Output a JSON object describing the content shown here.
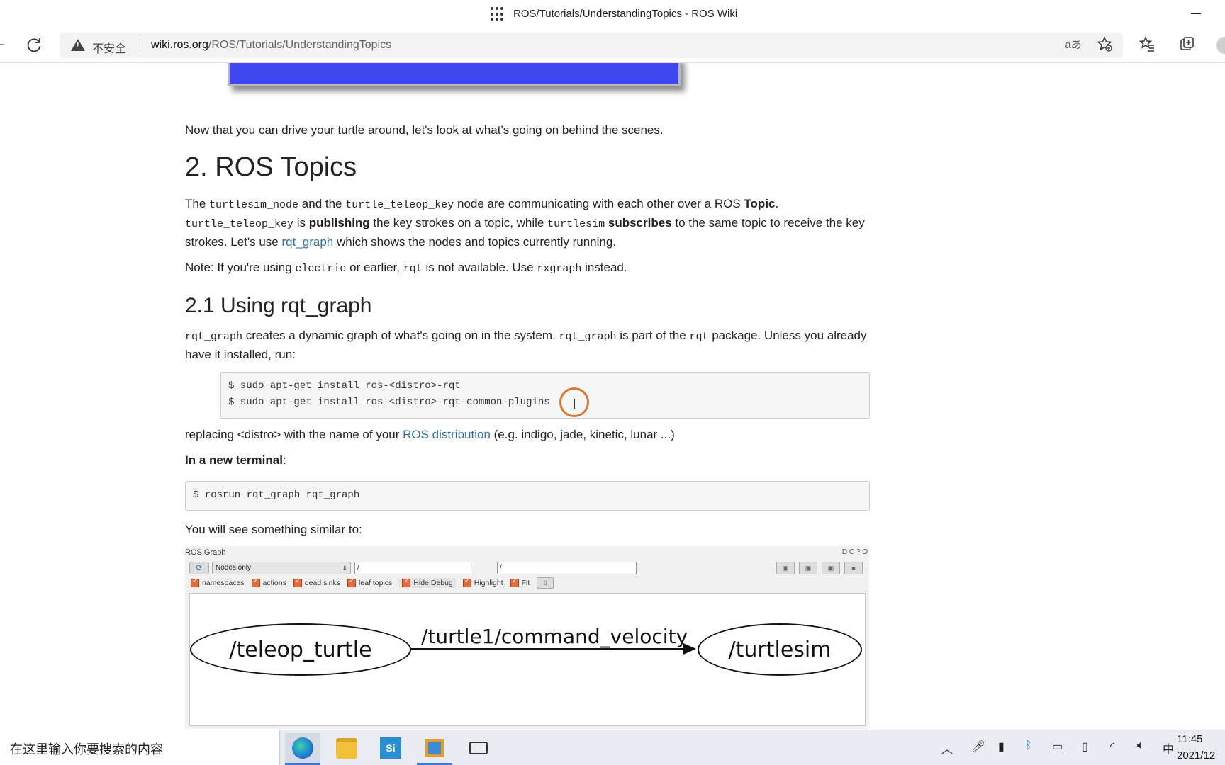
{
  "window": {
    "title": "ROS/Tutorials/UnderstandingTopics - ROS Wiki"
  },
  "address_bar": {
    "security_label": "不安全",
    "url_domain": "wiki.ros.org",
    "url_path": "/ROS/Tutorials/UnderstandingTopics",
    "read_aloud_glyph": "aあ"
  },
  "article": {
    "intro": "Now that you can drive your turtle around, let's look at what's going on behind the scenes.",
    "h_topics": "2. ROS Topics",
    "p1": {
      "t1": "The ",
      "c1": "turtlesim_node",
      "t2": " and the ",
      "c2": "turtle_teleop_key",
      "t3": " node are communicating with each other over a ROS ",
      "b1": "Topic",
      "t4": ". ",
      "c3": "turtle_teleop_key",
      "t5": " is ",
      "b2": "publishing",
      "t6": " the key strokes on a topic, while ",
      "c4": "turtlesim",
      "t7": " ",
      "b3": "subscribes",
      "t8": " to the same topic to receive the key strokes. Let's use ",
      "link": "rqt_graph",
      "t9": " which shows the nodes and topics currently running."
    },
    "note": {
      "t1": "Note: If you're using ",
      "c1": "electric",
      "t2": " or earlier, ",
      "c2": "rqt",
      "t3": " is not available. Use ",
      "c3": "rxgraph",
      "t4": " instead."
    },
    "h_using": "2.1 Using rqt_graph",
    "p2": {
      "c1": "rqt_graph",
      "t1": " creates a dynamic graph of what's going on in the system. ",
      "c2": "rqt_graph",
      "t2": " is part of the ",
      "c3": "rqt",
      "t3": " package. Unless you already have it installed, run:"
    },
    "code_install": [
      "$ sudo apt-get install ros-<distro>-rqt",
      "$ sudo apt-get install ros-<distro>-rqt-common-plugins"
    ],
    "replacing": {
      "t1": "replacing <distro> with the name of your ",
      "link": "ROS distribution",
      "t2": " (e.g. indigo, jade, kinetic, lunar ...)"
    },
    "new_terminal": {
      "bold": "In a new terminal",
      "tail": ":"
    },
    "code_run": "$ rosrun rqt_graph rqt_graph",
    "similar": "You will see something similar to:"
  },
  "ros_graph": {
    "title": "ROS Graph",
    "window_buttons": "D C ? O",
    "refresh_glyph": "⟳",
    "mode": "Nodes only",
    "ns_filter": "/",
    "topic_filter": "/",
    "checkboxes": [
      "namespaces",
      "actions",
      "dead sinks",
      "leaf topics",
      "Hide Debug",
      "Highlight",
      "Fit"
    ],
    "nodes": [
      "/teleop_turtle",
      "/turtlesim"
    ],
    "edge": "/turtle1/command_velocity"
  },
  "taskbar": {
    "search_placeholder": "在这里输入你要搜索的内容",
    "si_label": "Si",
    "ime": "中",
    "time": "11:45",
    "date": "2021/12"
  }
}
